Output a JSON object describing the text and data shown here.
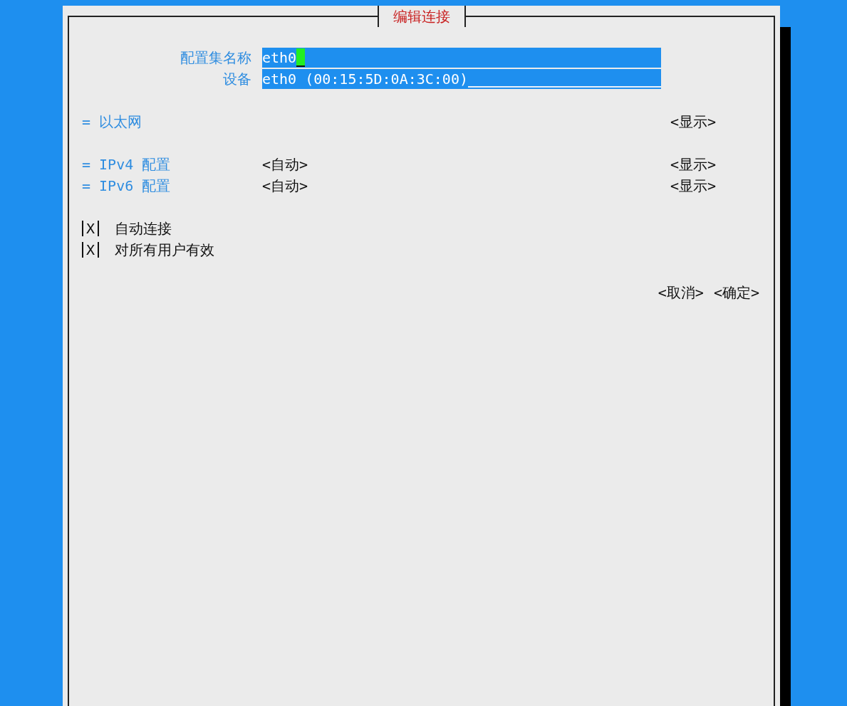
{
  "dialog": {
    "title": "编辑连接"
  },
  "fields": [
    {
      "label": "配置集名称",
      "value": "eth0",
      "focused": true
    },
    {
      "label": "设备",
      "value": "eth0 (00:15:5D:0A:3C:00)",
      "focused": false
    }
  ],
  "sections": [
    {
      "marker": "=",
      "label": "以太网",
      "show": "<显示>"
    },
    {
      "marker": "=",
      "label": "IPv4 配置",
      "mode": "<自动>",
      "show": "<显示>"
    },
    {
      "marker": "=",
      "label": "IPv6 配置",
      "mode": "<自动>",
      "show": "<显示>"
    }
  ],
  "checkboxes": [
    {
      "label": "自动连接",
      "checked": true,
      "mark": "X"
    },
    {
      "label": "对所有用户有效",
      "checked": true,
      "mark": "X"
    }
  ],
  "buttons": [
    "<取消>",
    "<确定>"
  ]
}
